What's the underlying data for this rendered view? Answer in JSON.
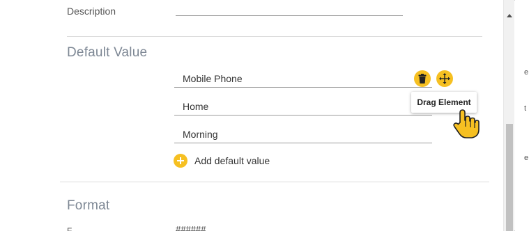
{
  "description": {
    "label": "Description"
  },
  "default_value": {
    "title": "Default Value",
    "items": [
      "Mobile Phone",
      "Home",
      "Morning"
    ],
    "add_label": "Add default value",
    "tooltip": "Drag Element"
  },
  "format": {
    "title": "Format",
    "field_label": "F",
    "value": "######"
  },
  "right_edge": {
    "chars": [
      "e",
      "t",
      "e"
    ]
  },
  "icons": {
    "trash": "trash-icon",
    "drag": "move-arrows-icon",
    "add": "plus-icon",
    "cursor": "hand-pointer-cursor"
  },
  "colors": {
    "accent": "#f6c022",
    "section_title": "#7d8794",
    "underline": "#9a9a9a"
  }
}
